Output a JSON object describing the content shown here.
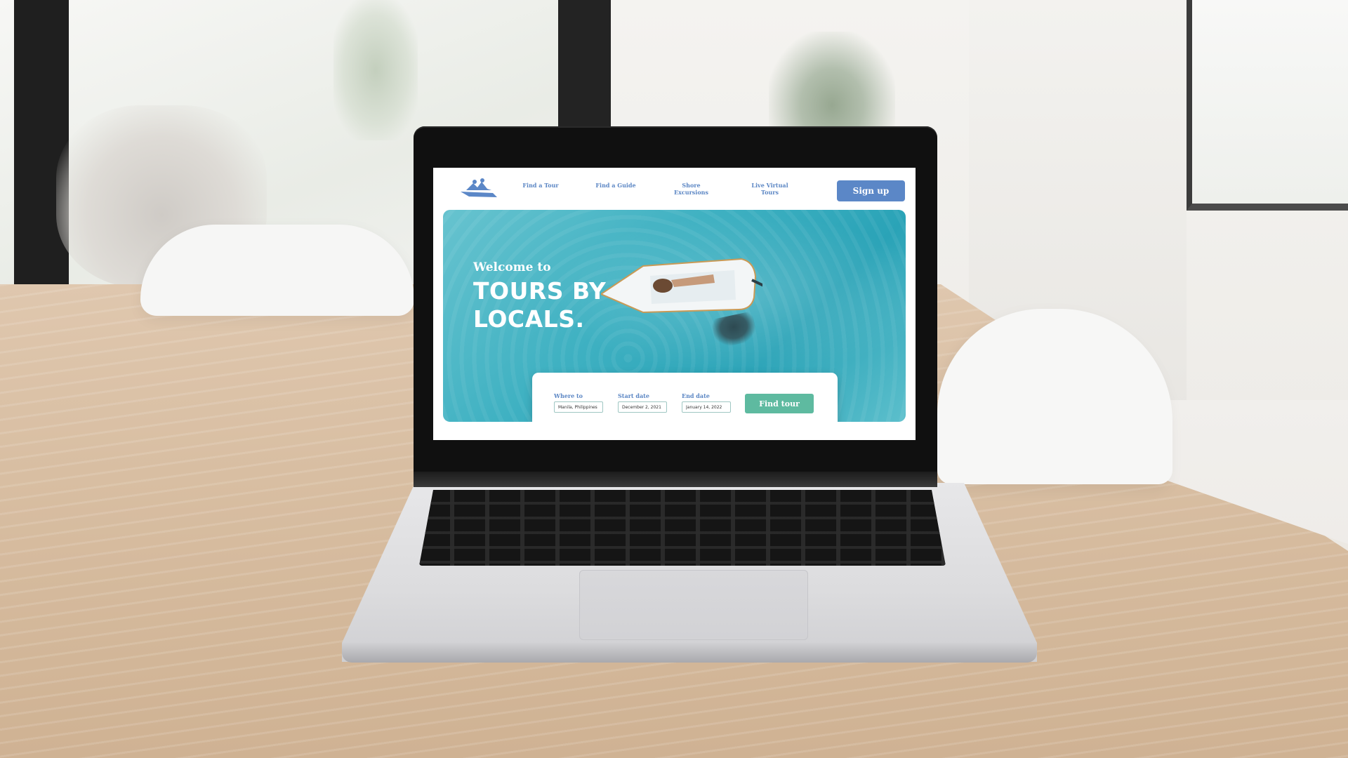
{
  "brand": {
    "logo_icon": "boat-logo-icon",
    "color_primary": "#5b87c7",
    "color_accent": "#5ebaa0"
  },
  "nav": {
    "links": [
      {
        "label": "Find a Tour"
      },
      {
        "label": "Find a Guide"
      },
      {
        "label": "Shore Excursions"
      },
      {
        "label": "Live Virtual Tours"
      }
    ],
    "signup_label": "Sign up"
  },
  "hero": {
    "welcome": "Welcome to",
    "title": "TOURS BY LOCALS."
  },
  "search": {
    "where": {
      "label": "Where to",
      "value": "Manila, Philippines"
    },
    "start": {
      "label": "Start date",
      "value": "December 2, 2021"
    },
    "end": {
      "label": "End date",
      "value": "January 14, 2022"
    },
    "submit_label": "Find tour"
  }
}
